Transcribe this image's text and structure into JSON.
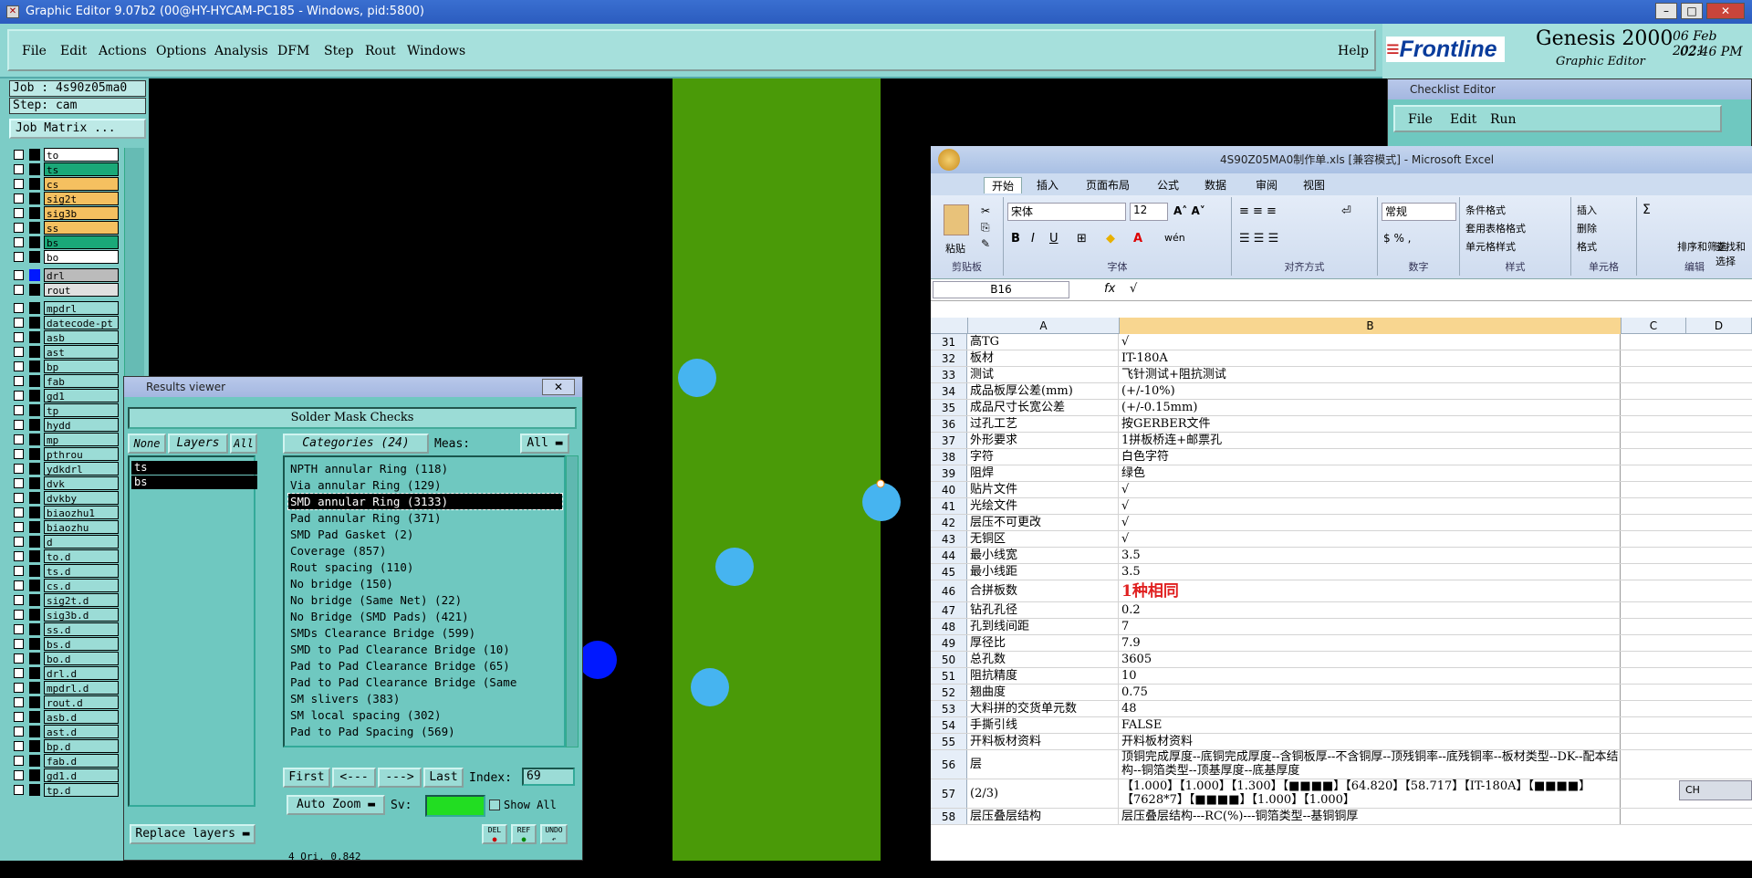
{
  "window": {
    "title": "Graphic Editor 9.07b2 (00@HY-HYCAM-PC185 - Windows, pid:5800)"
  },
  "menu": {
    "items": [
      "File",
      "Edit",
      "Actions",
      "Options",
      "Analysis",
      "DFM",
      "Step",
      "Rout",
      "Windows"
    ],
    "help": "Help"
  },
  "brand": {
    "logo": "Frontline",
    "product": "Genesis 2000",
    "subtitle": "Graphic Editor",
    "date": "06 Feb 2021",
    "time": "02:46 PM"
  },
  "job": {
    "job_label": "Job : 4s90z05ma0",
    "step_label": "Step: cam",
    "matrix_button": "Job Matrix ..."
  },
  "layers": [
    {
      "name": "to",
      "color": "#ffffff"
    },
    {
      "name": "ts",
      "color": "#1aa878"
    },
    {
      "name": "cs",
      "color": "#f5c060"
    },
    {
      "name": "sig2t",
      "color": "#f5c060"
    },
    {
      "name": "sig3b",
      "color": "#f5c060"
    },
    {
      "name": "ss",
      "color": "#f5c060"
    },
    {
      "name": "bs",
      "color": "#1aa878"
    },
    {
      "name": "bo",
      "color": "#ffffff"
    },
    {
      "name": "drl",
      "color": "#bbbbbb"
    },
    {
      "name": "rout",
      "color": "#e0e0e0"
    },
    {
      "name": "mpdrl",
      "color": "#9bdcd6"
    },
    {
      "name": "datecode-pt",
      "color": "#9bdcd6"
    },
    {
      "name": "asb",
      "color": "#9bdcd6"
    },
    {
      "name": "ast",
      "color": "#9bdcd6"
    },
    {
      "name": "bp",
      "color": "#9bdcd6"
    },
    {
      "name": "fab",
      "color": "#9bdcd6"
    },
    {
      "name": "gd1",
      "color": "#9bdcd6"
    },
    {
      "name": "tp",
      "color": "#9bdcd6"
    },
    {
      "name": "hydd",
      "color": "#9bdcd6"
    },
    {
      "name": "mp",
      "color": "#9bdcd6"
    },
    {
      "name": "pthrou",
      "color": "#9bdcd6"
    },
    {
      "name": "ydkdrl",
      "color": "#9bdcd6"
    },
    {
      "name": "dvk",
      "color": "#9bdcd6"
    },
    {
      "name": "dvkby",
      "color": "#9bdcd6"
    },
    {
      "name": "biaozhu1",
      "color": "#9bdcd6"
    },
    {
      "name": "biaozhu",
      "color": "#9bdcd6"
    },
    {
      "name": "d",
      "color": "#9bdcd6"
    },
    {
      "name": "to.d",
      "color": "#9bdcd6"
    },
    {
      "name": "ts.d",
      "color": "#9bdcd6"
    },
    {
      "name": "cs.d",
      "color": "#9bdcd6"
    },
    {
      "name": "sig2t.d",
      "color": "#9bdcd6"
    },
    {
      "name": "sig3b.d",
      "color": "#9bdcd6"
    },
    {
      "name": "ss.d",
      "color": "#9bdcd6"
    },
    {
      "name": "bs.d",
      "color": "#9bdcd6"
    },
    {
      "name": "bo.d",
      "color": "#9bdcd6"
    },
    {
      "name": "drl.d",
      "color": "#9bdcd6"
    },
    {
      "name": "mpdrl.d",
      "color": "#9bdcd6"
    },
    {
      "name": "rout.d",
      "color": "#9bdcd6"
    },
    {
      "name": "asb.d",
      "color": "#9bdcd6"
    },
    {
      "name": "ast.d",
      "color": "#9bdcd6"
    },
    {
      "name": "bp.d",
      "color": "#9bdcd6"
    },
    {
      "name": "fab.d",
      "color": "#9bdcd6"
    },
    {
      "name": "gd1.d",
      "color": "#9bdcd6"
    },
    {
      "name": "tp.d",
      "color": "#9bdcd6"
    }
  ],
  "results": {
    "title": "Results viewer",
    "header": "Solder Mask Checks",
    "none": "None",
    "layers": "Layers",
    "all": "All",
    "categories_label": "Categories (24)",
    "meas_label": "Meas:",
    "meas_value": "All",
    "selected_layers": [
      "ts",
      "bs"
    ],
    "categories": [
      "NPTH annular Ring (118)",
      "Via annular Ring (129)",
      "SMD annular Ring (3133)",
      "Pad annular Ring (371)",
      "SMD Pad Gasket (2)",
      "Coverage (857)",
      "Rout spacing (110)",
      "No bridge (150)",
      "No bridge (Same Net) (22)",
      "No Bridge (SMD Pads) (421)",
      "SMDs Clearance Bridge (599)",
      "SMD to Pad Clearance Bridge (10)",
      "Pad to Pad Clearance Bridge (65)",
      "Pad to Pad Clearance Bridge (Same",
      "SM slivers (383)",
      "SM local spacing (302)",
      "Pad to Pad Spacing (569)"
    ],
    "selected_index": 2,
    "nav": {
      "first": "First",
      "prev": "<---",
      "next": "--->",
      "last": "Last",
      "index_label": "Index:",
      "index_value": "69"
    },
    "auto_zoom": "Auto Zoom",
    "sv_label": "Sv:",
    "show_all": "Show All",
    "replace_layers": "Replace layers",
    "icons": [
      "DEL",
      "REF",
      "UNDO"
    ],
    "footer": "4 Ori.   0.842"
  },
  "checklist": {
    "title": "Checklist Editor",
    "menu": [
      "File",
      "Edit",
      "Run"
    ]
  },
  "excel": {
    "title": "4S90Z05MA0制作单.xls [兼容模式] - Microsoft Excel",
    "tabs": [
      "开始",
      "插入",
      "页面布局",
      "公式",
      "数据",
      "审阅",
      "视图"
    ],
    "font_name": "宋体",
    "font_size": "12",
    "number_format": "常规",
    "groups": [
      "剪贴板",
      "字体",
      "对齐方式",
      "数字",
      "样式",
      "单元格",
      "编辑"
    ],
    "buttons": {
      "paste": "粘贴",
      "cond_fmt": "条件格式",
      "table_fmt": "套用表格格式",
      "cell_style": "单元格样式",
      "insert": "插入",
      "delete": "删除",
      "format": "格式",
      "sort": "排序和筛选",
      "find": "查找和选择"
    },
    "name_box": "B16",
    "formula": "√",
    "columns": [
      "A",
      "B",
      "C",
      "D"
    ],
    "rows": [
      {
        "n": "31",
        "a": "高TG",
        "b": "√"
      },
      {
        "n": "32",
        "a": "板材",
        "b": "IT-180A"
      },
      {
        "n": "33",
        "a": "测试",
        "b": "飞针测试+阻抗测试"
      },
      {
        "n": "34",
        "a": "成品板厚公差(mm)",
        "b": "(+/-10%)"
      },
      {
        "n": "35",
        "a": "成品尺寸长宽公差",
        "b": "(+/-0.15mm)"
      },
      {
        "n": "36",
        "a": "过孔工艺",
        "b": "按GERBER文件"
      },
      {
        "n": "37",
        "a": "外形要求",
        "b": "1拼板桥连+邮票孔"
      },
      {
        "n": "38",
        "a": "字符",
        "b": "白色字符"
      },
      {
        "n": "39",
        "a": "阻焊",
        "b": "绿色"
      },
      {
        "n": "40",
        "a": "贴片文件",
        "b": "√"
      },
      {
        "n": "41",
        "a": "光绘文件",
        "b": "√"
      },
      {
        "n": "42",
        "a": "层压不可更改",
        "b": "√"
      },
      {
        "n": "43",
        "a": "无铜区",
        "b": "√"
      },
      {
        "n": "44",
        "a": "最小线宽",
        "b": "3.5"
      },
      {
        "n": "45",
        "a": "最小线距",
        "b": "3.5"
      },
      {
        "n": "46",
        "a": "合拼板数",
        "b": "1种相同",
        "red": true
      },
      {
        "n": "47",
        "a": "钻孔孔径",
        "b": "0.2"
      },
      {
        "n": "48",
        "a": "孔到线间距",
        "b": "7"
      },
      {
        "n": "49",
        "a": "厚径比",
        "b": "7.9"
      },
      {
        "n": "50",
        "a": "总孔数",
        "b": "3605"
      },
      {
        "n": "51",
        "a": "阻抗精度",
        "b": "10"
      },
      {
        "n": "52",
        "a": "翘曲度",
        "b": "0.75"
      },
      {
        "n": "53",
        "a": "大料拼的交货单元数",
        "b": "48"
      },
      {
        "n": "54",
        "a": "手撕引线",
        "b": "FALSE"
      },
      {
        "n": "55",
        "a": "开料板材资料",
        "b": "开料板材资料"
      },
      {
        "n": "56",
        "a": "层",
        "b": "顶铜完成厚度--底铜完成厚度--含铜板厚--不含铜厚--顶残铜率--底残铜率--板材类型--DK--配本结构--铜箔类型--顶基厚度--底基厚度"
      },
      {
        "n": "57",
        "a": "(2/3)",
        "b": "【1.000】【1.000】【1.300】【■■■■】【64.820】【58.717】【IT-180A】【■■■■】【7628*7】【■■■■】【1.000】【1.000】"
      },
      {
        "n": "58",
        "a": "层压叠层结构",
        "b": "层压叠层结构---RC(%)---铜箔类型--基铜铜厚"
      }
    ],
    "ime": "CH"
  }
}
